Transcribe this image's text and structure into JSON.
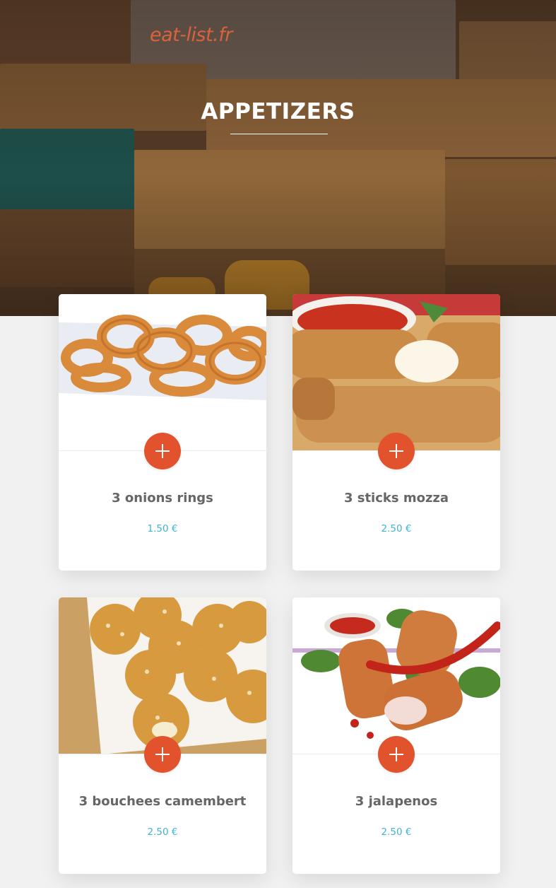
{
  "site": {
    "logo_text": "eat-list.fr"
  },
  "hero": {
    "title": "APPETIZERS"
  },
  "menu": {
    "items": [
      {
        "name": "3 onions rings",
        "price": "1.50 €",
        "image": "onion-rings-photo"
      },
      {
        "name": "3 sticks mozza",
        "price": "2.50 €",
        "image": "mozzarella-sticks-photo"
      },
      {
        "name": "3 bouchees camembert",
        "price": "2.50 €",
        "image": "camembert-bites-photo"
      },
      {
        "name": "3 jalapenos",
        "price": "2.50 €",
        "image": "jalapeno-poppers-photo"
      }
    ]
  },
  "icons": {
    "add": "plus-icon"
  },
  "colors": {
    "accent": "#e2522d",
    "logo": "#d9633d",
    "price": "#3fb2d6",
    "title_text": "#666666",
    "page_background": "#f1f1f1"
  }
}
